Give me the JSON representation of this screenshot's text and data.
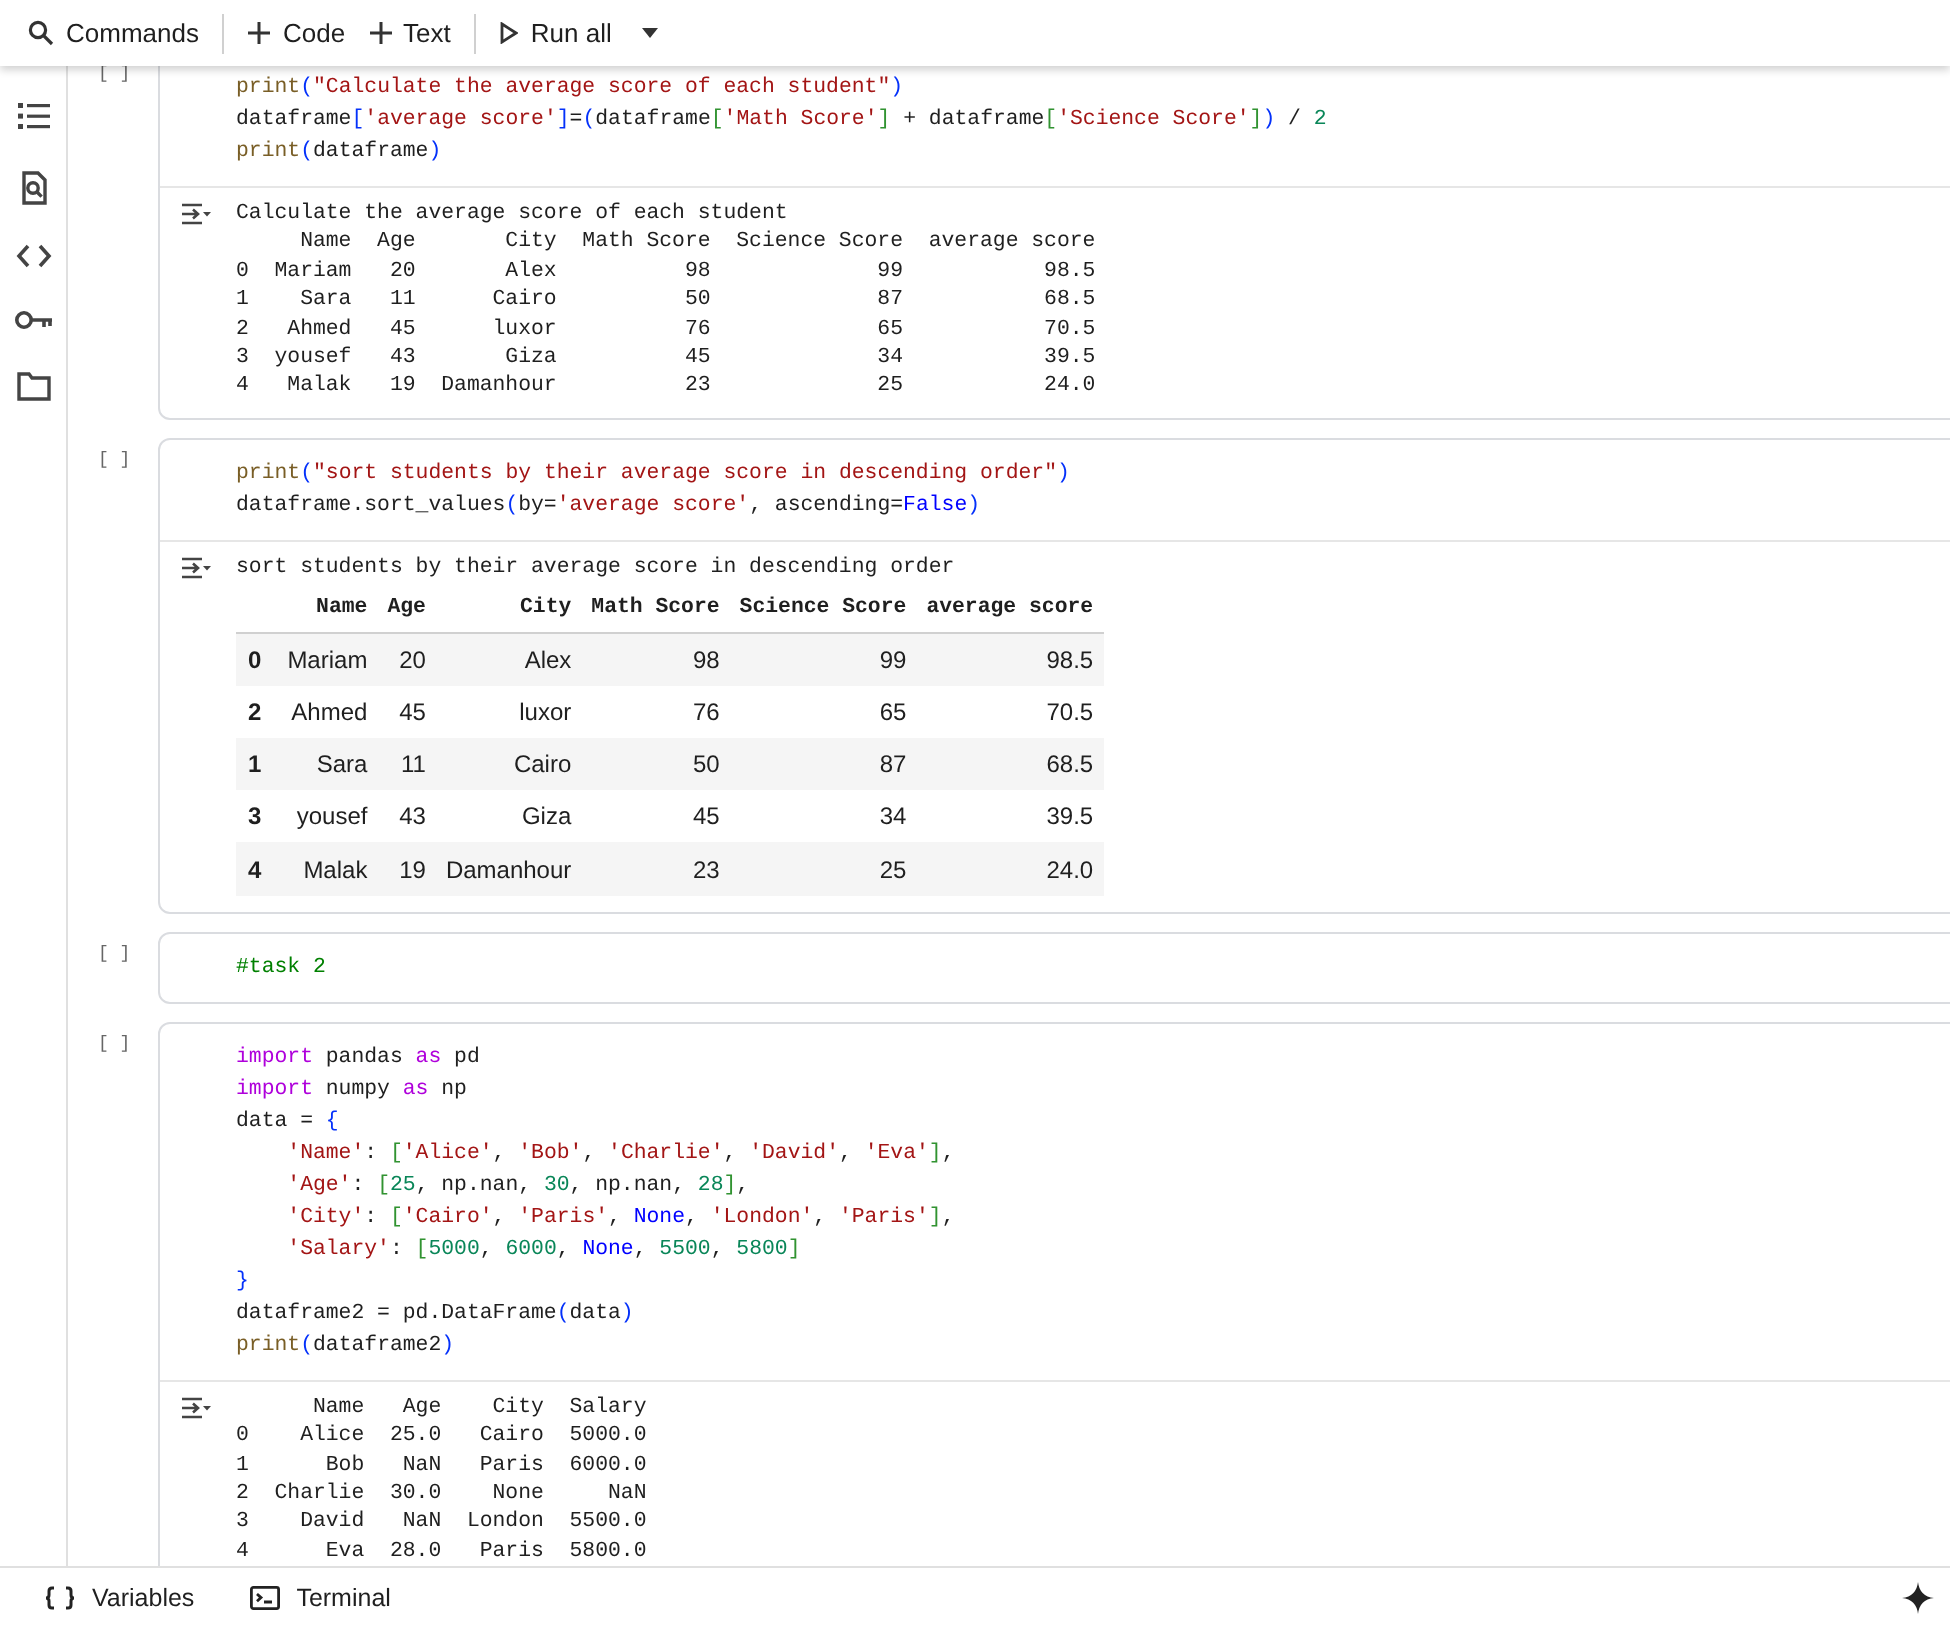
{
  "toolbar": {
    "items": [
      {
        "kind": "search",
        "label": "Commands"
      },
      {
        "kind": "add",
        "label": "Code"
      },
      {
        "kind": "add",
        "label": "Text"
      },
      {
        "kind": "run",
        "label": "Run all"
      }
    ]
  },
  "cells": [
    {
      "run_marker": "[ ]",
      "code": [
        [
          {
            "text": "print",
            "kind": "fn"
          },
          {
            "text": "(",
            "kind": "b1"
          },
          {
            "text": "\"Calculate the average score of each student\"",
            "kind": "str"
          },
          {
            "text": ")",
            "kind": "b1"
          }
        ],
        [
          {
            "text": "dataframe",
            "kind": "p"
          },
          {
            "text": "[",
            "kind": "b1"
          },
          {
            "text": "'average score'",
            "kind": "str"
          },
          {
            "text": "]",
            "kind": "b1"
          },
          {
            "text": "=",
            "kind": "p"
          },
          {
            "text": "(",
            "kind": "b1"
          },
          {
            "text": "dataframe",
            "kind": "p"
          },
          {
            "text": "[",
            "kind": "b2"
          },
          {
            "text": "'Math Score'",
            "kind": "str"
          },
          {
            "text": "]",
            "kind": "b2"
          },
          {
            "text": " + dataframe",
            "kind": "p"
          },
          {
            "text": "[",
            "kind": "b2"
          },
          {
            "text": "'Science Score'",
            "kind": "str"
          },
          {
            "text": "]",
            "kind": "b2"
          },
          {
            "text": ")",
            "kind": "b1"
          },
          {
            "text": " / ",
            "kind": "p"
          },
          {
            "text": "2",
            "kind": "num"
          }
        ],
        [
          {
            "text": "print",
            "kind": "fn"
          },
          {
            "text": "(",
            "kind": "b1"
          },
          {
            "text": "dataframe",
            "kind": "p"
          },
          {
            "text": ")",
            "kind": "b1"
          }
        ]
      ],
      "output": {
        "kind": "text",
        "lines": [
          "Calculate the average score of each student",
          "     Name  Age       City  Math Score  Science Score  average score",
          "0  Mariam   20       Alex          98             99           98.5",
          "1    Sara   11      Cairo          50             87           68.5",
          "2   Ahmed   45      luxor          76             65           70.5",
          "3  yousef   43       Giza          45             34           39.5",
          "4   Malak   19  Damanhour          23             25           24.0"
        ]
      }
    },
    {
      "run_marker": "[ ]",
      "code": [
        [
          {
            "text": "print",
            "kind": "fn"
          },
          {
            "text": "(",
            "kind": "b1"
          },
          {
            "text": "\"sort students by their average score in descending order\"",
            "kind": "str"
          },
          {
            "text": ")",
            "kind": "b1"
          }
        ],
        [
          {
            "text": "dataframe.sort_values",
            "kind": "p"
          },
          {
            "text": "(",
            "kind": "b1"
          },
          {
            "text": "by=",
            "kind": "p"
          },
          {
            "text": "'average score'",
            "kind": "str"
          },
          {
            "text": ", ascending=",
            "kind": "p"
          },
          {
            "text": "False",
            "kind": "const"
          },
          {
            "text": ")",
            "kind": "b1"
          }
        ]
      ],
      "output": {
        "kind": "table",
        "caption": "sort students by their average score in descending order",
        "columns": [
          "Name",
          "Age",
          "City",
          "Math Score",
          "Science Score",
          "average score"
        ],
        "rows": [
          {
            "index": "0",
            "cells": [
              "Mariam",
              "20",
              "Alex",
              "98",
              "99",
              "98.5"
            ]
          },
          {
            "index": "2",
            "cells": [
              "Ahmed",
              "45",
              "luxor",
              "76",
              "65",
              "70.5"
            ]
          },
          {
            "index": "1",
            "cells": [
              "Sara",
              "11",
              "Cairo",
              "50",
              "87",
              "68.5"
            ]
          },
          {
            "index": "3",
            "cells": [
              "yousef",
              "43",
              "Giza",
              "45",
              "34",
              "39.5"
            ]
          },
          {
            "index": "4",
            "cells": [
              "Malak",
              "19",
              "Damanhour",
              "23",
              "25",
              "24.0"
            ]
          }
        ]
      }
    },
    {
      "run_marker": "[ ]",
      "code": [
        [
          {
            "text": "#task 2",
            "kind": "cm"
          }
        ]
      ]
    },
    {
      "run_marker": "[ ]",
      "code": [
        [
          {
            "text": "import",
            "kind": "kw"
          },
          {
            "text": " pandas ",
            "kind": "p"
          },
          {
            "text": "as",
            "kind": "kw"
          },
          {
            "text": " pd",
            "kind": "p"
          }
        ],
        [
          {
            "text": "import",
            "kind": "kw"
          },
          {
            "text": " numpy ",
            "kind": "p"
          },
          {
            "text": "as",
            "kind": "kw"
          },
          {
            "text": " np",
            "kind": "p"
          }
        ],
        [
          {
            "text": "data = ",
            "kind": "p"
          },
          {
            "text": "{",
            "kind": "b1"
          }
        ],
        [
          {
            "text": "    'Name'",
            "kind": "str"
          },
          {
            "text": ": ",
            "kind": "p"
          },
          {
            "text": "[",
            "kind": "b2"
          },
          {
            "text": "'Alice'",
            "kind": "str"
          },
          {
            "text": ", ",
            "kind": "p"
          },
          {
            "text": "'Bob'",
            "kind": "str"
          },
          {
            "text": ", ",
            "kind": "p"
          },
          {
            "text": "'Charlie'",
            "kind": "str"
          },
          {
            "text": ", ",
            "kind": "p"
          },
          {
            "text": "'David'",
            "kind": "str"
          },
          {
            "text": ", ",
            "kind": "p"
          },
          {
            "text": "'Eva'",
            "kind": "str"
          },
          {
            "text": "]",
            "kind": "b2"
          },
          {
            "text": ",",
            "kind": "p"
          }
        ],
        [
          {
            "text": "    'Age'",
            "kind": "str"
          },
          {
            "text": ": ",
            "kind": "p"
          },
          {
            "text": "[",
            "kind": "b2"
          },
          {
            "text": "25",
            "kind": "num"
          },
          {
            "text": ", np.nan, ",
            "kind": "p"
          },
          {
            "text": "30",
            "kind": "num"
          },
          {
            "text": ", np.nan, ",
            "kind": "p"
          },
          {
            "text": "28",
            "kind": "num"
          },
          {
            "text": "]",
            "kind": "b2"
          },
          {
            "text": ",",
            "kind": "p"
          }
        ],
        [
          {
            "text": "    'City'",
            "kind": "str"
          },
          {
            "text": ": ",
            "kind": "p"
          },
          {
            "text": "[",
            "kind": "b2"
          },
          {
            "text": "'Cairo'",
            "kind": "str"
          },
          {
            "text": ", ",
            "kind": "p"
          },
          {
            "text": "'Paris'",
            "kind": "str"
          },
          {
            "text": ", ",
            "kind": "p"
          },
          {
            "text": "None",
            "kind": "const"
          },
          {
            "text": ", ",
            "kind": "p"
          },
          {
            "text": "'London'",
            "kind": "str"
          },
          {
            "text": ", ",
            "kind": "p"
          },
          {
            "text": "'Paris'",
            "kind": "str"
          },
          {
            "text": "]",
            "kind": "b2"
          },
          {
            "text": ",",
            "kind": "p"
          }
        ],
        [
          {
            "text": "    'Salary'",
            "kind": "str"
          },
          {
            "text": ": ",
            "kind": "p"
          },
          {
            "text": "[",
            "kind": "b2"
          },
          {
            "text": "5000",
            "kind": "num"
          },
          {
            "text": ", ",
            "kind": "p"
          },
          {
            "text": "6000",
            "kind": "num"
          },
          {
            "text": ", ",
            "kind": "p"
          },
          {
            "text": "None",
            "kind": "const"
          },
          {
            "text": ", ",
            "kind": "p"
          },
          {
            "text": "5500",
            "kind": "num"
          },
          {
            "text": ", ",
            "kind": "p"
          },
          {
            "text": "5800",
            "kind": "num"
          },
          {
            "text": "]",
            "kind": "b2"
          }
        ],
        [
          {
            "text": "}",
            "kind": "b1"
          }
        ],
        [
          {
            "text": "dataframe2 = pd.DataFrame",
            "kind": "p"
          },
          {
            "text": "(",
            "kind": "b1"
          },
          {
            "text": "data",
            "kind": "p"
          },
          {
            "text": ")",
            "kind": "b1"
          }
        ],
        [
          {
            "text": "print",
            "kind": "fn"
          },
          {
            "text": "(",
            "kind": "b1"
          },
          {
            "text": "dataframe2",
            "kind": "p"
          },
          {
            "text": ")",
            "kind": "b1"
          }
        ]
      ],
      "output": {
        "kind": "text",
        "lines": [
          "      Name   Age    City  Salary",
          "0    Alice  25.0   Cairo  5000.0",
          "1      Bob   NaN   Paris  6000.0",
          "2  Charlie  30.0    None     NaN",
          "3    David   NaN  London  5500.0",
          "4      Eva  28.0   Paris  5800.0"
        ]
      }
    }
  ],
  "bottom_bar": {
    "items": [
      {
        "kind": "variables",
        "label": "Variables"
      },
      {
        "kind": "terminal",
        "label": "Terminal"
      }
    ]
  }
}
